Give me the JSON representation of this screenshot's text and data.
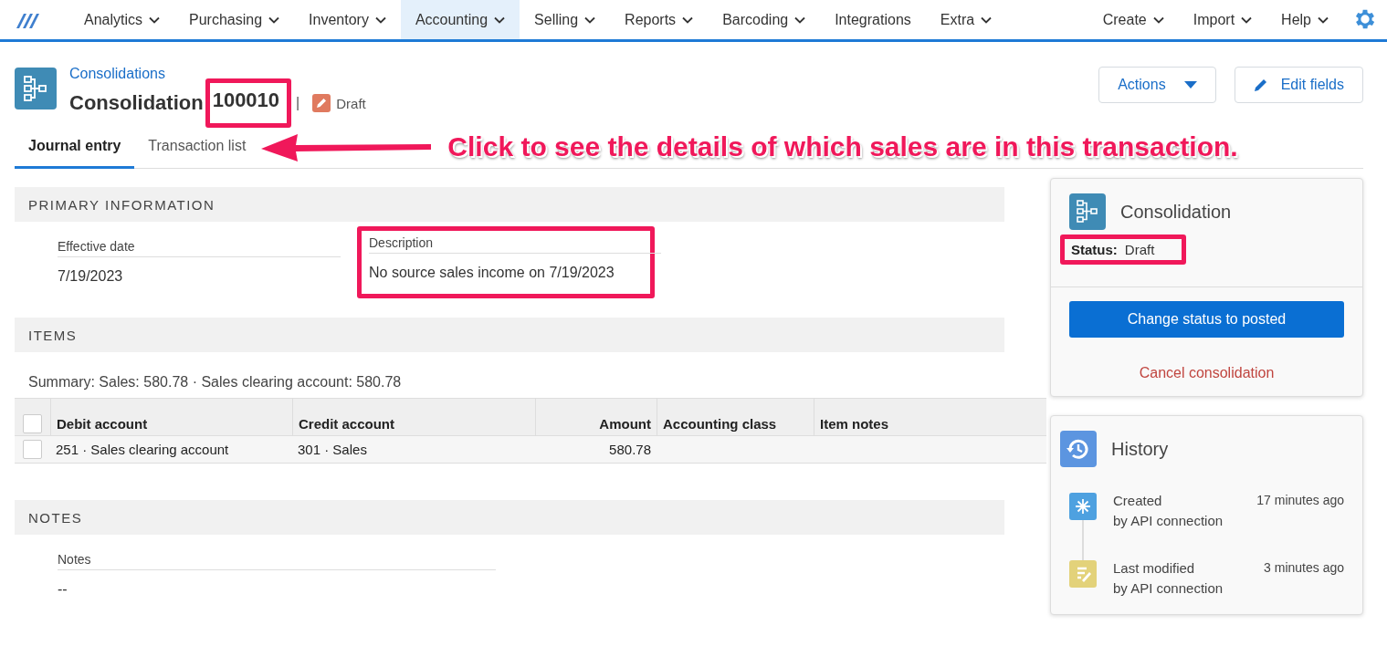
{
  "nav": {
    "items": [
      {
        "label": "Analytics",
        "has_menu": true,
        "selected": false
      },
      {
        "label": "Purchasing",
        "has_menu": true,
        "selected": false
      },
      {
        "label": "Inventory",
        "has_menu": true,
        "selected": false
      },
      {
        "label": "Accounting",
        "has_menu": true,
        "selected": true
      },
      {
        "label": "Selling",
        "has_menu": true,
        "selected": false
      },
      {
        "label": "Reports",
        "has_menu": true,
        "selected": false
      },
      {
        "label": "Barcoding",
        "has_menu": true,
        "selected": false
      },
      {
        "label": "Integrations",
        "has_menu": false,
        "selected": false
      },
      {
        "label": "Extra",
        "has_menu": true,
        "selected": false
      }
    ],
    "right_items": [
      {
        "label": "Create",
        "has_menu": true
      },
      {
        "label": "Import",
        "has_menu": true
      },
      {
        "label": "Help",
        "has_menu": true
      }
    ]
  },
  "header": {
    "breadcrumb": "Consolidations",
    "title": "Consolidation",
    "number": "100010",
    "separator": "|",
    "status": "Draft",
    "actions": [
      "Actions",
      "Edit fields"
    ]
  },
  "tabs": [
    {
      "label": "Journal entry",
      "selected": true
    },
    {
      "label": "Transaction list",
      "selected": false
    }
  ],
  "annotation": {
    "callout": "Click to see the details of which sales are in this transaction."
  },
  "primary_information": {
    "heading": "PRIMARY INFORMATION",
    "fields": [
      {
        "label": "Effective date",
        "value": "7/19/2023",
        "highlighted": false
      },
      {
        "label": "Description",
        "value": "No source sales income on 7/19/2023",
        "highlighted": true
      }
    ]
  },
  "items": {
    "heading": "ITEMS",
    "summary": "Summary: Sales: 580.78 · Sales clearing account: 580.78",
    "header_checked": false,
    "columns": [
      "Debit account",
      "Credit account",
      "Amount",
      "Accounting class",
      "Item notes"
    ],
    "rows": [
      {
        "checked": false,
        "debit_account": "251 · Sales clearing account",
        "credit_account": "301 · Sales",
        "amount": "580.78"
      }
    ]
  },
  "notes": {
    "heading": "NOTES",
    "label": "Notes",
    "value": "--"
  },
  "status_card": {
    "title": "Consolidation",
    "status_label": "Status:",
    "status": "Draft",
    "primary_button": "Change status to posted",
    "cancel_link": "Cancel consolidation"
  },
  "history": {
    "title": "History",
    "entries": [
      {
        "kind": "created",
        "action": "Created",
        "by": "by API connection",
        "time": "17 minutes ago"
      },
      {
        "kind": "modified",
        "action": "Last modified",
        "by": "by API connection",
        "time": "3 minutes ago"
      }
    ]
  }
}
